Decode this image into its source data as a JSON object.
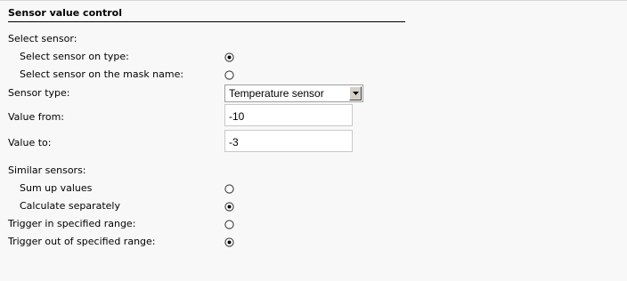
{
  "panel": {
    "title": "Sensor value control"
  },
  "select_sensor": {
    "heading": "Select sensor:",
    "on_type_label": "Select sensor on type:",
    "on_type_selected": true,
    "on_mask_label": "Select sensor on the mask name:",
    "on_mask_selected": false
  },
  "sensor_type": {
    "label": "Sensor type:",
    "value": "Temperature sensor"
  },
  "value_from": {
    "label": "Value from:",
    "value": "-10"
  },
  "value_to": {
    "label": "Value to:",
    "value": "-3"
  },
  "similar_sensors": {
    "heading": "Similar sensors:",
    "sum_label": "Sum up values",
    "sum_selected": false,
    "separate_label": "Calculate separately",
    "separate_selected": true
  },
  "trigger": {
    "in_range_label": "Trigger in specified range:",
    "in_range_selected": false,
    "out_range_label": "Trigger out of specified range:",
    "out_range_selected": true
  },
  "icons": {
    "radio": "radio-button-icon",
    "dropdown": "dropdown-arrow-icon"
  }
}
